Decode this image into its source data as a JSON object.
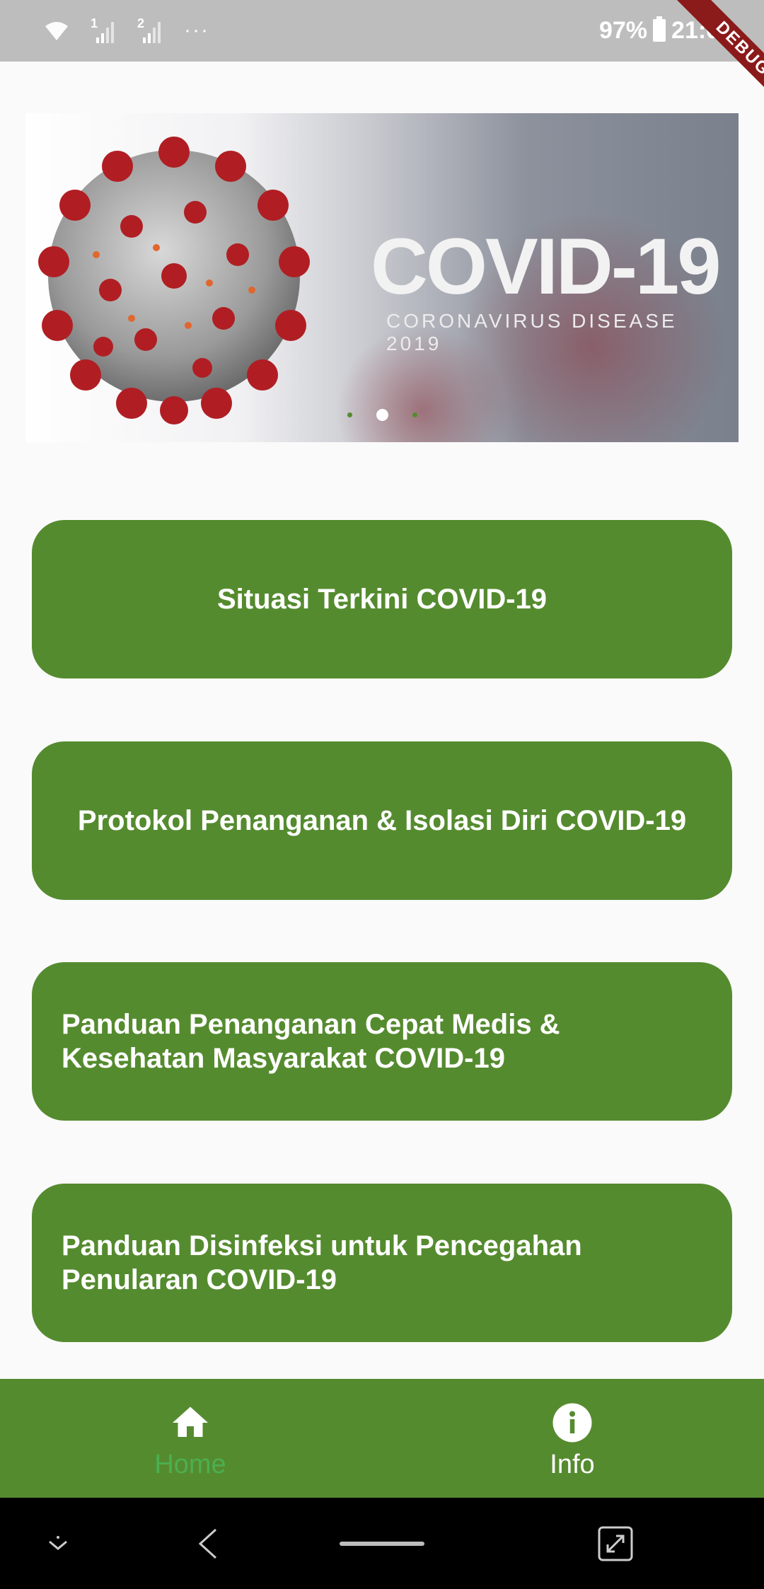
{
  "status_bar": {
    "battery": "97%",
    "time": "21:09",
    "sim1": "1",
    "sim2": "2",
    "more": "···"
  },
  "debug_banner": "DEBUG",
  "carousel": {
    "title": "COVID-19",
    "subtitle": "CORONAVIRUS DISEASE 2019",
    "page_count": 3,
    "active_index": 1
  },
  "menu": [
    {
      "label": "Situasi Terkini COVID-19"
    },
    {
      "label": "Protokol Penanganan & Isolasi Diri COVID-19"
    },
    {
      "label": "Panduan Penanganan Cepat Medis & Kesehatan Masyarakat COVID-19"
    },
    {
      "label": "Panduan Disinfeksi untuk Pencegahan Penularan COVID-19"
    }
  ],
  "bottom_nav": {
    "items": [
      {
        "label": "Home",
        "icon": "home-icon",
        "selected": true
      },
      {
        "label": "Info",
        "icon": "info-icon",
        "selected": false
      }
    ]
  },
  "colors": {
    "primary": "#558b2f",
    "selected_label": "#4caf50",
    "status_bar": "#bdbdbd",
    "background": "#fafafa"
  }
}
